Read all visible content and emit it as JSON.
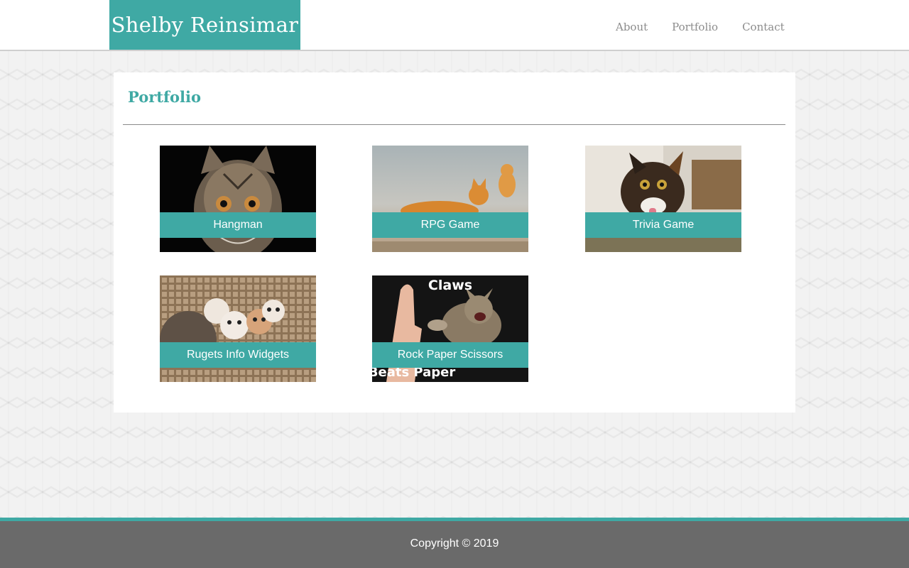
{
  "header": {
    "brand": "Shelby Reinsimar",
    "nav": [
      "About",
      "Portfolio",
      "Contact"
    ]
  },
  "main": {
    "title": "Portfolio",
    "projects": [
      {
        "label": "Hangman",
        "image": "cat-face-photo"
      },
      {
        "label": "RPG Game",
        "image": "orange-kitten-photo"
      },
      {
        "label": "Trivia Game",
        "image": "tortoiseshell-cat-photo"
      },
      {
        "label": "Rugets Info Widgets",
        "image": "kittens-in-basket-photo"
      },
      {
        "label": "Rock Paper Scissors",
        "image": "claws-meme-photo",
        "image_text": [
          "Claws",
          "Beats Paper"
        ]
      }
    ]
  },
  "footer": {
    "copyright": "Copyright © 2019"
  },
  "colors": {
    "accent": "#3fa9a4",
    "footer_bg": "#6a6a6a",
    "nav_text": "#8c8c8c"
  }
}
